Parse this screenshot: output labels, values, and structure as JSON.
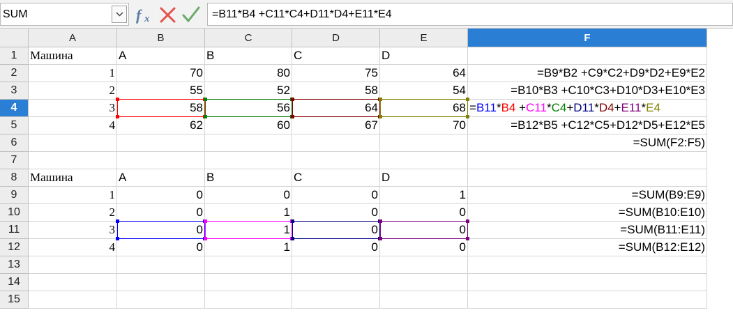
{
  "name_box": {
    "value": "SUM"
  },
  "formula_bar": {
    "icons": [
      "function-wizard-icon",
      "cancel-icon",
      "accept-icon"
    ],
    "formula": "=B11*B4 +C11*C4+D11*D4+E11*E4"
  },
  "columns": [
    "A",
    "B",
    "C",
    "D",
    "E",
    "F"
  ],
  "active_column": "F",
  "rows": [
    "1",
    "2",
    "3",
    "4",
    "5",
    "6",
    "7",
    "8",
    "9",
    "10",
    "11",
    "12",
    "13",
    "14",
    "15"
  ],
  "active_row": "4",
  "cells": {
    "A1": "Машина",
    "B1": "A",
    "C1": "B",
    "D1": "C",
    "E1": "D",
    "A2": "1",
    "B2": "70",
    "C2": "80",
    "D2": "75",
    "E2": "64",
    "F2": "=B9*B2 +C9*C2+D9*D2+E9*E2",
    "A3": "2",
    "B3": "55",
    "C3": "52",
    "D3": "58",
    "E3": "54",
    "F3": "=B10*B3 +C10*C3+D10*D3+E10*E3",
    "A4": "3",
    "B4": "58",
    "C4": "56",
    "D4": "64",
    "E4": "68",
    "A5": "4",
    "B5": "62",
    "C5": "60",
    "D5": "67",
    "E5": "70",
    "F5": "=B12*B5 +C12*C5+D12*D5+E12*E5",
    "F6": "=SUM(F2:F5)",
    "A8": "Машина",
    "B8": "A",
    "C8": "B",
    "D8": "C",
    "E8": "D",
    "A9": "1",
    "B9": "0",
    "C9": "0",
    "D9": "0",
    "E9": "1",
    "F9": "=SUM(B9:E9)",
    "A10": "2",
    "B10": "0",
    "C10": "1",
    "D10": "0",
    "E10": "0",
    "F10": "=SUM(B10:E10)",
    "A11": "3",
    "B11": "0",
    "C11": "1",
    "D11": "0",
    "E11": "0",
    "F11": "=SUM(B11:E11)",
    "A12": "4",
    "B12": "0",
    "C12": "1",
    "D12": "0",
    "E12": "0",
    "F12": "=SUM(B12:E12)"
  },
  "active_cell_formula_parts": [
    {
      "text": "=",
      "color": "#000000"
    },
    {
      "text": "B11",
      "color": "#0000ff"
    },
    {
      "text": "*",
      "color": "#000000"
    },
    {
      "text": "B4",
      "color": "#ff0000"
    },
    {
      "text": " +",
      "color": "#000000"
    },
    {
      "text": "C11",
      "color": "#ff00ff"
    },
    {
      "text": "*",
      "color": "#000000"
    },
    {
      "text": "C4",
      "color": "#008000"
    },
    {
      "text": "+",
      "color": "#000000"
    },
    {
      "text": "D11",
      "color": "#000080"
    },
    {
      "text": "*",
      "color": "#000000"
    },
    {
      "text": "D4",
      "color": "#800000"
    },
    {
      "text": "+",
      "color": "#000000"
    },
    {
      "text": "E11",
      "color": "#800080"
    },
    {
      "text": "*",
      "color": "#000000"
    },
    {
      "text": "E4",
      "color": "#808000"
    }
  ],
  "reference_colors": {
    "B4": "#ff0000",
    "C4": "#008000",
    "D4": "#800000",
    "E4": "#808000",
    "B11": "#0000ff",
    "C11": "#ff00ff",
    "D11": "#000080",
    "E11": "#800080"
  },
  "colors": {
    "header_bg": "#ededed",
    "active_header": "#2a7fd4",
    "grid_line": "#d4d4d4"
  }
}
